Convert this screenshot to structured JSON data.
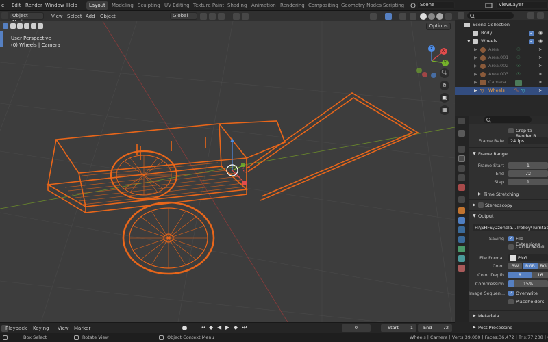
{
  "menu": [
    "e",
    "Edit",
    "Render",
    "Window",
    "Help"
  ],
  "workspaces": [
    {
      "label": "Layout",
      "active": true
    },
    {
      "label": "Modeling"
    },
    {
      "label": "Sculpting"
    },
    {
      "label": "UV Editing"
    },
    {
      "label": "Texture Paint"
    },
    {
      "label": "Shading"
    },
    {
      "label": "Animation"
    },
    {
      "label": "Rendering"
    },
    {
      "label": "Compositing"
    },
    {
      "label": "Geometry Nodes"
    },
    {
      "label": "Scripting"
    }
  ],
  "scene_name": "Scene",
  "view_layer": "ViewLayer",
  "viewport_header": {
    "mode": "Object Mode",
    "view": "View",
    "select": "Select",
    "add": "Add",
    "object": "Object",
    "transform": "Global"
  },
  "viewport": {
    "options": "Options",
    "perspective": "User Perspective",
    "context": "(0) Wheels | Camera"
  },
  "gizmo": {
    "x": "X",
    "y": "Y",
    "z": "Z"
  },
  "outliner": {
    "title": "Scene Collection",
    "rows": [
      {
        "label": "Body"
      },
      {
        "label": "Wheels"
      },
      {
        "label": "Area"
      },
      {
        "label": "Area.001"
      },
      {
        "label": "Area.002"
      },
      {
        "label": "Area.003"
      },
      {
        "label": "Camera"
      },
      {
        "label": "Wheels"
      }
    ]
  },
  "properties": {
    "crop": "Crop to Render R",
    "frame_rate_label": "Frame Rate",
    "frame_rate": "24 fps",
    "frame_range": "Frame Range",
    "frame_start_label": "Frame Start",
    "frame_start": "1",
    "end_label": "End",
    "end": "72",
    "step_label": "Step",
    "step": "1",
    "time_stretching": "Time Stretching",
    "stereoscopy": "Stereoscopy",
    "output": "Output",
    "path": "H:\\SHFS\\Ozonela...Trolley\\Turntable\\",
    "saving_label": "Saving",
    "file_extensions": "File Extensions",
    "cache_result": "Cache Result",
    "file_format_label": "File Format",
    "file_format": "PNG",
    "color_label": "Color",
    "color_bw": "BW",
    "color_rgb": "RGB",
    "color_rgba": "RG",
    "depth_label": "Color Depth",
    "depth_8": "8",
    "depth_16": "16",
    "compression_label": "Compression",
    "compression": "15%",
    "compression_value": 0.15,
    "image_sequence_label": "Image Sequen...",
    "overwrite": "Overwrite",
    "placeholders": "Placeholders",
    "metadata": "Metadata",
    "post_processing": "Post Processing"
  },
  "timeline": {
    "playback": "Playback",
    "keying": "Keying",
    "view": "View",
    "marker": "Marker",
    "current_frame": "0",
    "start_label": "Start",
    "start": "1",
    "end_label": "End",
    "end": "72"
  },
  "status": {
    "box_select": "Box Select",
    "rotate_view": "Rotate View",
    "context_menu": "Object Context Menu",
    "stats": "Wheels | Camera | Verts:39,000 | Faces:36,472 | Tris:77,208 | Objec"
  }
}
